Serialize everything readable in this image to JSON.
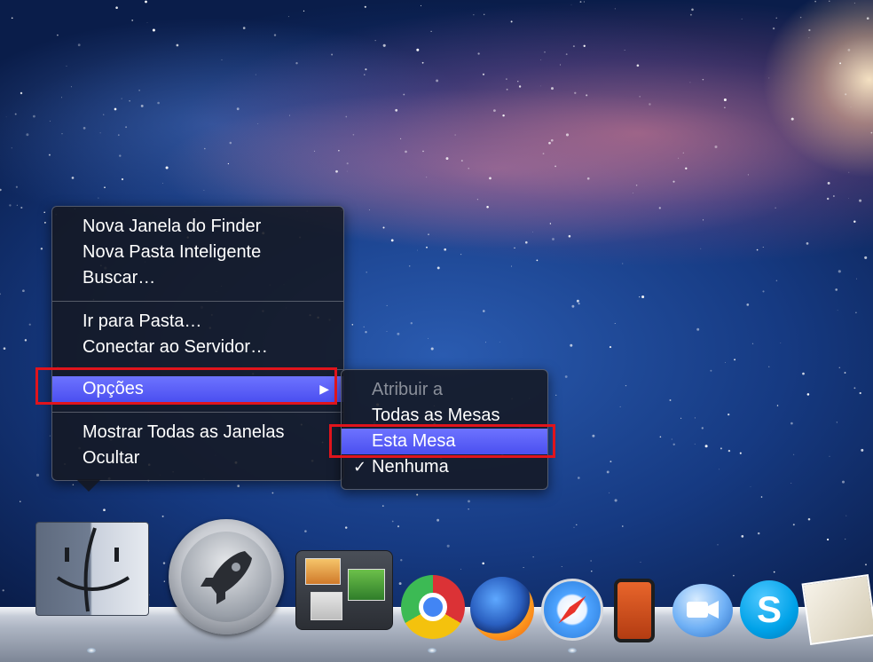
{
  "context_menu": {
    "items": [
      {
        "label": "Nova Janela do Finder"
      },
      {
        "label": "Nova Pasta Inteligente"
      },
      {
        "label": "Buscar…"
      },
      {
        "label": "Ir para Pasta…"
      },
      {
        "label": "Conectar ao Servidor…"
      },
      {
        "label": "Opções",
        "highlighted": true,
        "submenu_arrow": "▶"
      },
      {
        "label": "Mostrar Todas as Janelas"
      },
      {
        "label": "Ocultar"
      }
    ]
  },
  "submenu": {
    "header": "Atribuir a",
    "items": [
      {
        "label": "Todas as Mesas"
      },
      {
        "label": "Esta Mesa",
        "highlighted": true
      },
      {
        "label": "Nenhuma",
        "checked": true,
        "check_mark": "✓"
      }
    ]
  },
  "highlight_color": "#e0141c",
  "selection_color": "#5b60f8",
  "dock": {
    "apps": [
      {
        "icon": "finder-icon"
      },
      {
        "icon": "launchpad-icon"
      },
      {
        "icon": "mission-control-icon"
      },
      {
        "icon": "chrome-icon"
      },
      {
        "icon": "firefox-icon"
      },
      {
        "icon": "safari-icon"
      },
      {
        "icon": "iphone-config-icon"
      },
      {
        "icon": "facetime-icon"
      },
      {
        "icon": "skype-icon",
        "glyph": "S"
      },
      {
        "icon": "preview-icon"
      }
    ]
  }
}
